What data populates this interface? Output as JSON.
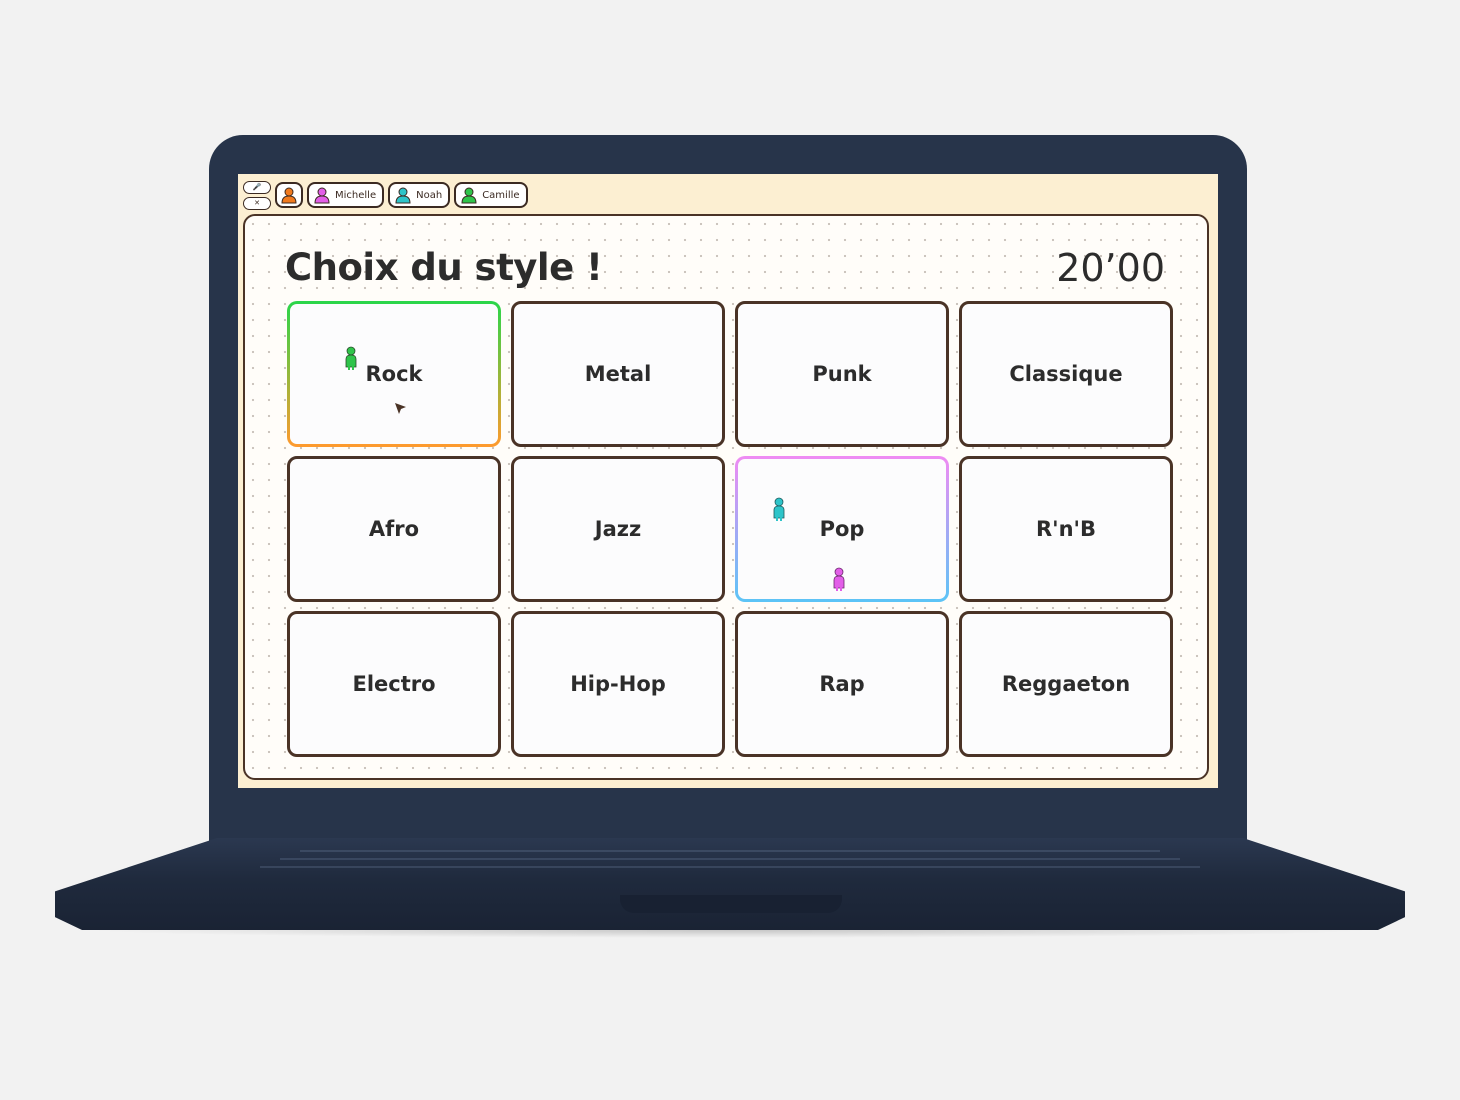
{
  "colors": {
    "laptop_body": "#27344a",
    "screen_background": "#fcefd2",
    "card_border": "#4a3326",
    "self_player": "#f07a1e",
    "michelle": "#e25ee8",
    "noah": "#2ec4c9",
    "camille": "#2fc44a"
  },
  "topbar": {
    "controls": [
      "mic-icon",
      "tools-icon"
    ],
    "players": [
      {
        "name": "Michelle",
        "color": "#e25ee8"
      },
      {
        "name": "Noah",
        "color": "#2ec4c9"
      },
      {
        "name": "Camille",
        "color": "#2fc44a"
      }
    ]
  },
  "main": {
    "title": "Choix du style !",
    "timer": "20’00",
    "styles": [
      {
        "label": "Rock"
      },
      {
        "label": "Metal"
      },
      {
        "label": "Punk"
      },
      {
        "label": "Classique"
      },
      {
        "label": "Afro"
      },
      {
        "label": "Jazz"
      },
      {
        "label": "Pop"
      },
      {
        "label": "R'n'B"
      },
      {
        "label": "Electro"
      },
      {
        "label": "Hip-Hop"
      },
      {
        "label": "Rap"
      },
      {
        "label": "Reggaeton"
      }
    ]
  }
}
